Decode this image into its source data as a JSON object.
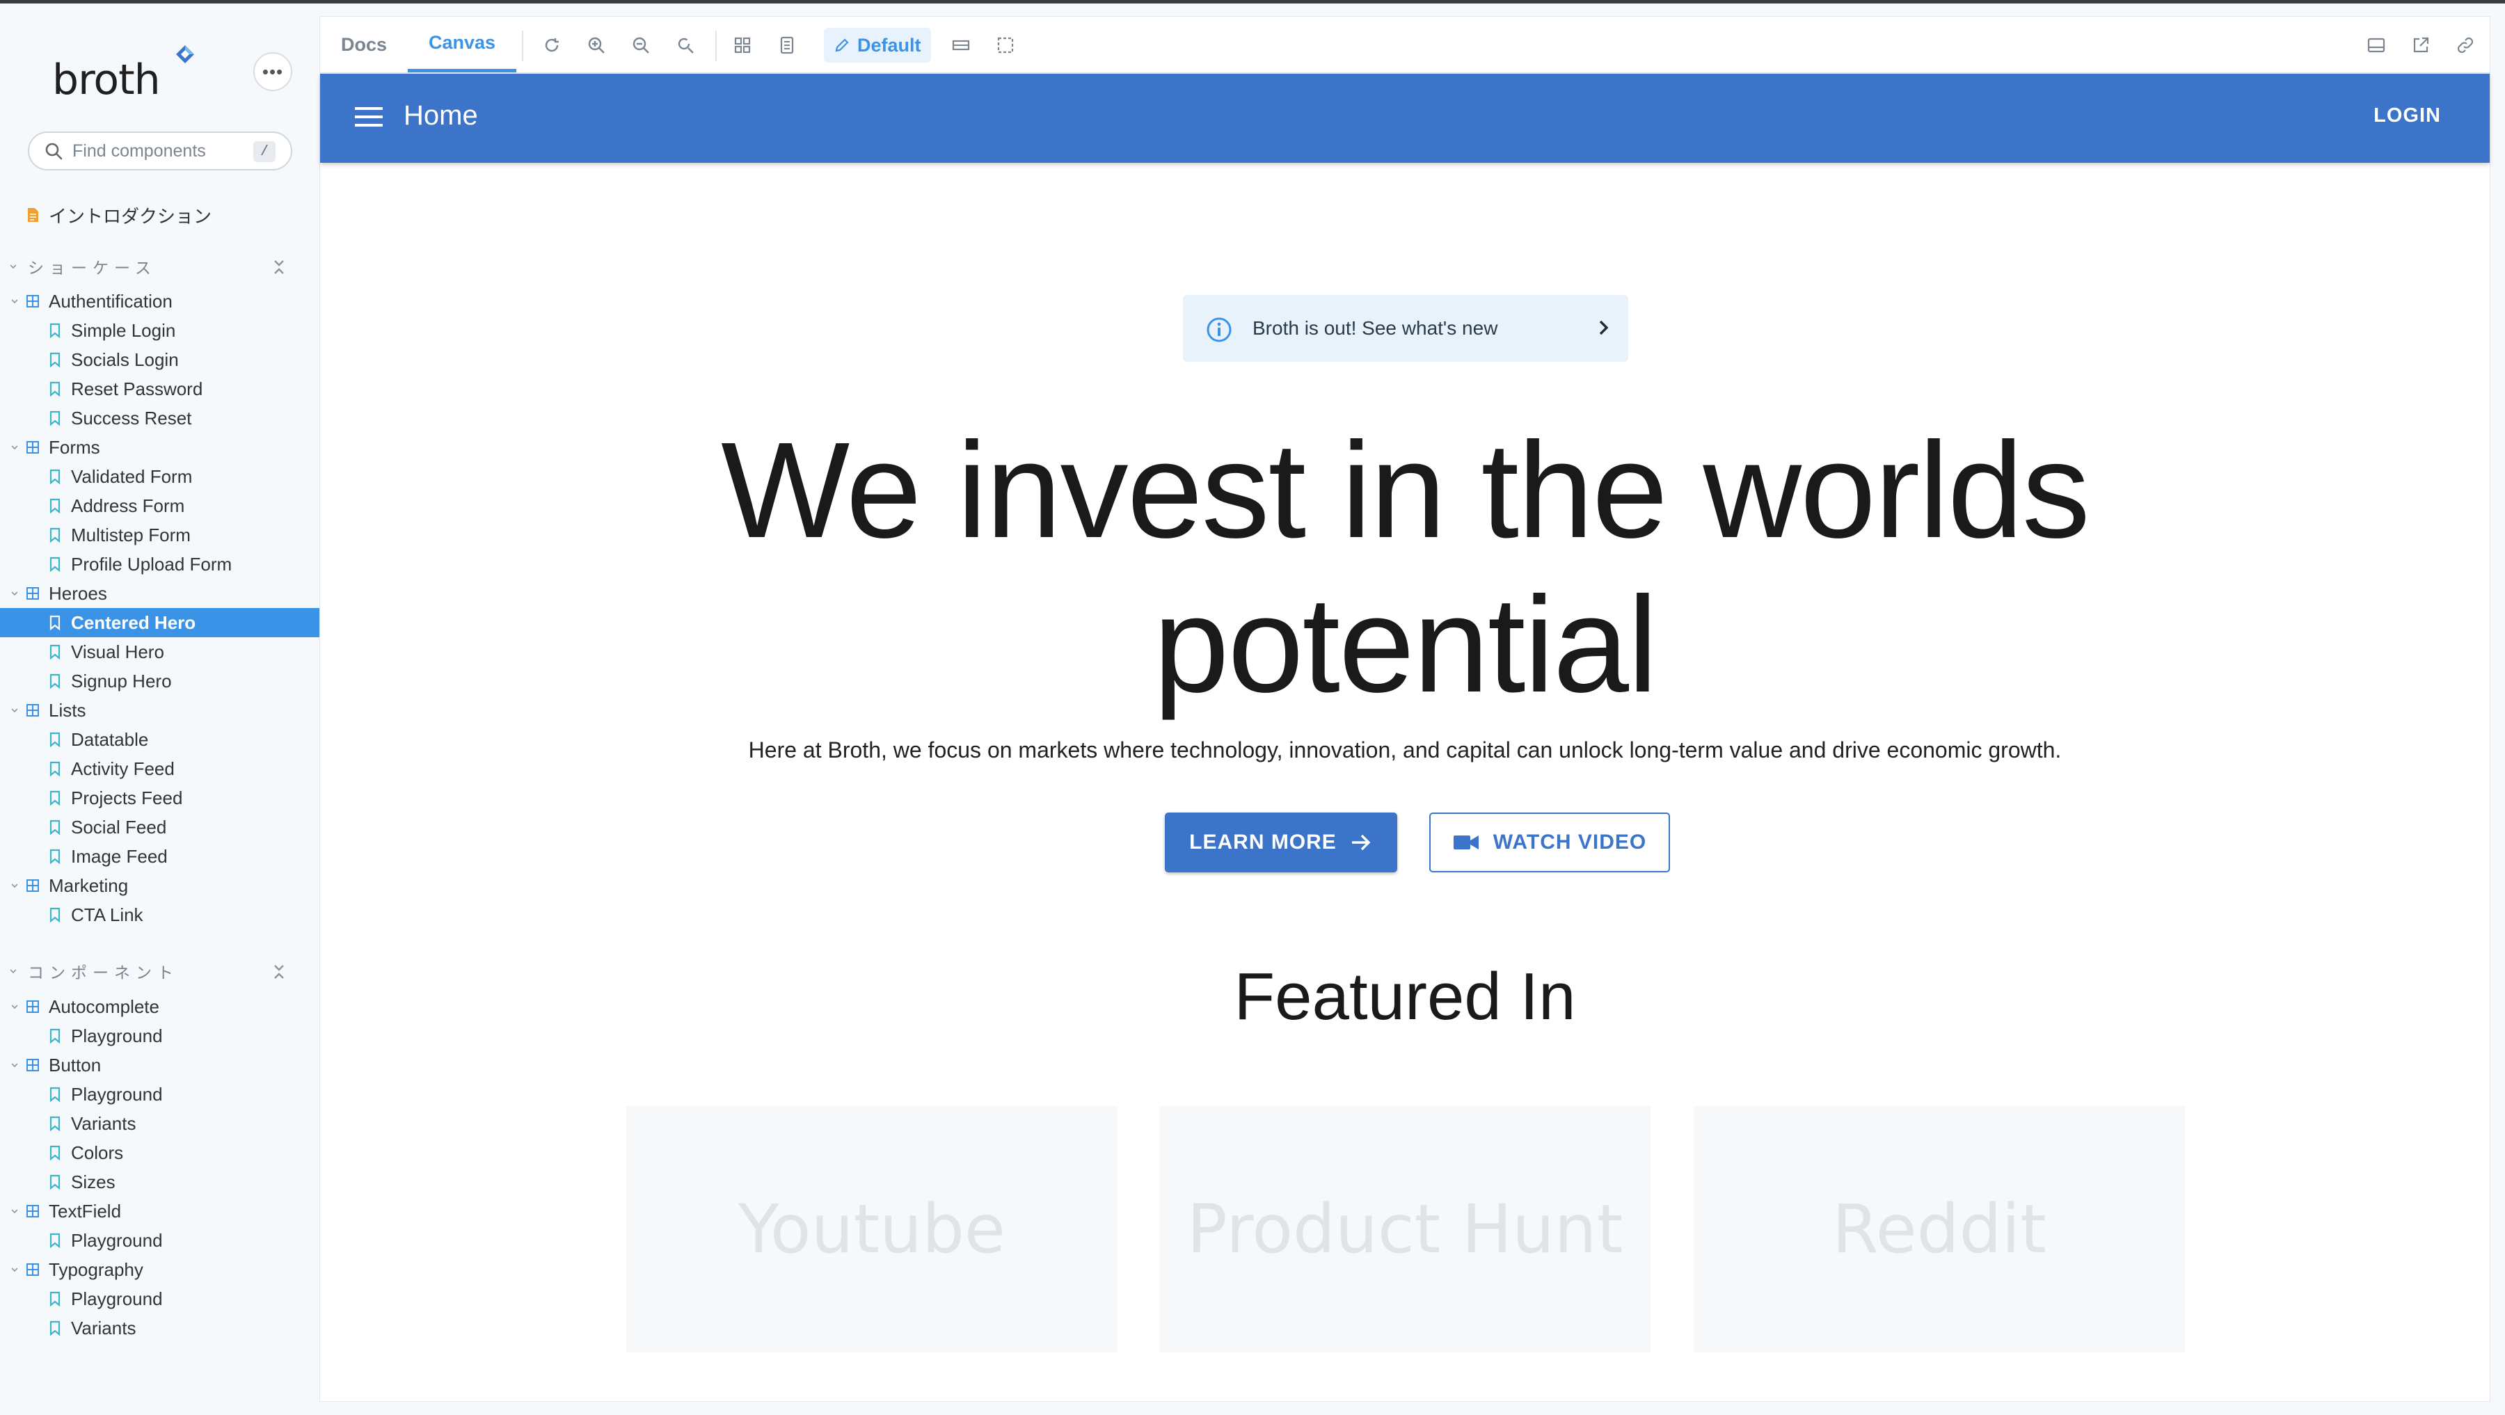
{
  "sidebar": {
    "brand": "broth",
    "more_label": "•••",
    "search": {
      "placeholder": "Find components",
      "shortcut": "/"
    },
    "intro": "イントロダクション",
    "sections": [
      {
        "title": "ショーケース"
      },
      {
        "title": "コンポーネント"
      }
    ],
    "groups": [
      {
        "label": "Authentification",
        "stories": [
          "Simple Login",
          "Socials Login",
          "Reset Password",
          "Success Reset"
        ]
      },
      {
        "label": "Forms",
        "stories": [
          "Validated Form",
          "Address Form",
          "Multistep Form",
          "Profile Upload Form"
        ]
      },
      {
        "label": "Heroes",
        "stories": [
          "Centered Hero",
          "Visual Hero",
          "Signup Hero"
        ]
      },
      {
        "label": "Lists",
        "stories": [
          "Datatable",
          "Activity Feed",
          "Projects Feed",
          "Social Feed",
          "Image Feed"
        ]
      },
      {
        "label": "Marketing",
        "stories": [
          "CTA Link"
        ]
      },
      {
        "label": "Autocomplete",
        "stories": [
          "Playground"
        ]
      },
      {
        "label": "Button",
        "stories": [
          "Playground",
          "Variants",
          "Colors",
          "Sizes"
        ]
      },
      {
        "label": "TextField",
        "stories": [
          "Playground"
        ]
      },
      {
        "label": "Typography",
        "stories": [
          "Playground",
          "Variants"
        ]
      }
    ],
    "selected": "Centered Hero"
  },
  "toolbar": {
    "tabs": [
      "Docs",
      "Canvas"
    ],
    "active_tab": "Canvas",
    "mode": "Default"
  },
  "preview": {
    "appbar": {
      "title": "Home",
      "login": "LOGIN"
    },
    "banner": "Broth is out! See what's new",
    "hero_title_line1": "We invest in the worlds",
    "hero_title_line2": "potential",
    "hero_subtitle": "Here at Broth, we focus on markets where technology, innovation, and capital can unlock long-term value and drive economic growth.",
    "learn_more": "LEARN MORE",
    "watch_video": "WATCH VIDEO",
    "featured_title": "Featured In",
    "featured_logos": [
      "Youtube",
      "Product Hunt",
      "Reddit"
    ]
  },
  "colors": {
    "accent": "#3b93e8",
    "appbar": "#3b74c8",
    "selected_row": "#3b93e8",
    "group_icon": "#3b93e8",
    "story_icon": "#3bb5c8",
    "intro_icon": "#f0a030"
  }
}
